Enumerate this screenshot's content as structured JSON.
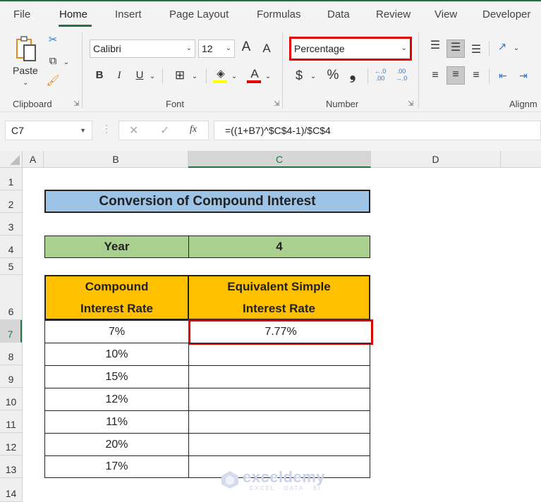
{
  "ribbon": {
    "tabs": [
      "File",
      "Home",
      "Insert",
      "Page Layout",
      "Formulas",
      "Data",
      "Review",
      "View",
      "Developer"
    ],
    "active_tab": "Home",
    "clipboard": {
      "label": "Clipboard",
      "paste_label": "Paste",
      "icons": [
        "paste-icon",
        "cut-icon",
        "copy-icon",
        "format-painter-icon"
      ]
    },
    "font": {
      "label": "Font",
      "font_name": "Calibri",
      "font_size": "12",
      "grow_label": "A",
      "shrink_label": "A",
      "bold": "B",
      "italic": "I",
      "underline": "U",
      "font_color_glyph": "A",
      "fill_color": "#ffff00",
      "font_color": "#e00000"
    },
    "number": {
      "label": "Number",
      "format": "Percentage",
      "currency": "$",
      "percent": "%",
      "comma": "❟",
      "inc_decimal": "←.0 .00",
      "dec_decimal": ".00 →.0"
    },
    "alignment": {
      "label": "Alignm"
    }
  },
  "formula_bar": {
    "name_box": "C7",
    "fx_label": "fx",
    "formula": "=((1+B7)^$C$4-1)/$C$4"
  },
  "columns": [
    "A",
    "B",
    "C",
    "D"
  ],
  "selected_column": "C",
  "rows": [
    "1",
    "2",
    "3",
    "4",
    "5",
    "6",
    "7",
    "8",
    "9",
    "10",
    "11",
    "12",
    "13",
    "14"
  ],
  "selected_row": "7",
  "sheet": {
    "title": "Conversion of Compound Interest",
    "year_label": "Year",
    "year_value": "4",
    "header_b_line1": "Compound",
    "header_b_line2": "Interest Rate",
    "header_c_line1": "Equivalent Simple",
    "header_c_line2": "Interest Rate",
    "table": [
      {
        "compound": "7%",
        "simple": "7.77%"
      },
      {
        "compound": "10%",
        "simple": ""
      },
      {
        "compound": "15%",
        "simple": ""
      },
      {
        "compound": "12%",
        "simple": ""
      },
      {
        "compound": "11%",
        "simple": ""
      },
      {
        "compound": "20%",
        "simple": ""
      },
      {
        "compound": "17%",
        "simple": ""
      }
    ]
  },
  "watermark": {
    "brand": "exceldemy",
    "tagline": "EXCEL · DATA · BI"
  },
  "colors": {
    "accent": "#217346",
    "title_fill": "#9dc3e6",
    "year_fill": "#a9d08e",
    "header_fill": "#ffc000",
    "highlight": "#e00000"
  }
}
